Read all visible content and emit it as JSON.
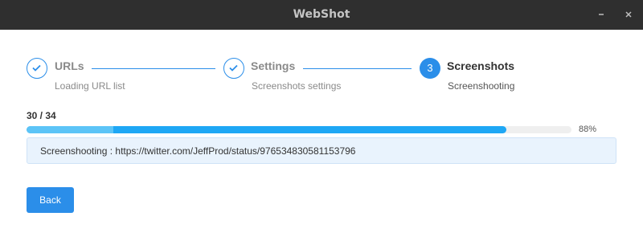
{
  "window": {
    "title": "WebShot"
  },
  "steps": [
    {
      "title": "URLs",
      "description": "Loading URL list",
      "state": "done"
    },
    {
      "title": "Settings",
      "description": "Screenshots settings",
      "state": "done"
    },
    {
      "number": "3",
      "title": "Screenshots",
      "description": "Screenshooting",
      "state": "active"
    }
  ],
  "progress": {
    "count_text": "30 / 34",
    "percent_text": "88%",
    "percent_value": 88,
    "segment_fraction": 0.16
  },
  "status": {
    "text": "Screenshooting : https://twitter.com/JeffProd/status/976534830581153796"
  },
  "buttons": {
    "back_label": "Back"
  },
  "colors": {
    "accent": "#2b8ee9",
    "progress": "#1ea7f5",
    "titlebar": "#2f2f2f"
  }
}
